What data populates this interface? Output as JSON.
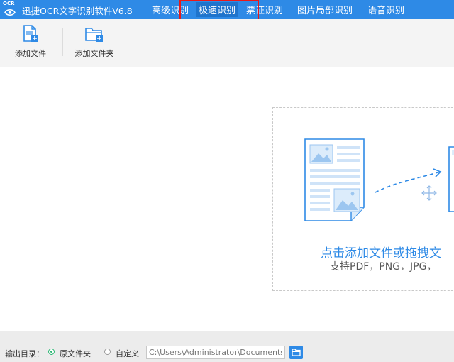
{
  "app": {
    "logo_text": "OCR",
    "title": "迅捷OCR文字识别软件V6.8"
  },
  "nav": {
    "items": [
      {
        "label": "高级识别"
      },
      {
        "label": "极速识别"
      },
      {
        "label": "票证识别"
      },
      {
        "label": "图片局部识别"
      },
      {
        "label": "语音识别"
      }
    ],
    "active_index": 1
  },
  "toolbar": {
    "add_file_label": "添加文件",
    "add_folder_label": "添加文件夹"
  },
  "dropzone": {
    "title": "点击添加文件或拖拽文",
    "subtitle": "支持PDF，PNG，JPG，"
  },
  "footer": {
    "output_label": "输出目录：",
    "option_original": "原文件夹",
    "option_custom": "自定义",
    "selected_option": "original",
    "path_value": "C:\\Users\\Administrator\\Documents"
  },
  "colors": {
    "accent": "#2e8ae6",
    "highlight": "#e81a1a",
    "radio_selected": "#2bb673"
  }
}
